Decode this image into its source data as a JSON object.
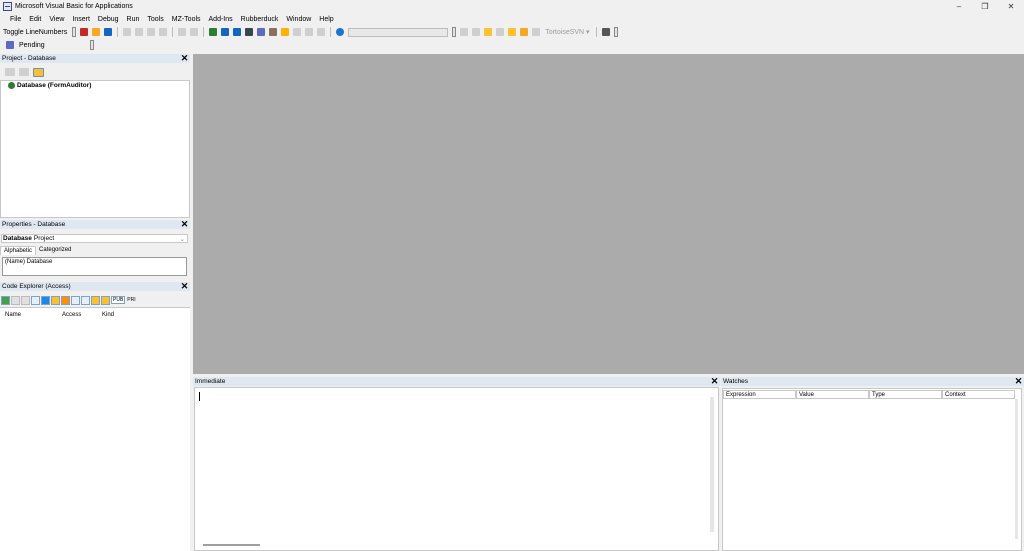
{
  "window": {
    "title": "Microsoft Visual Basic for Applications",
    "controls": {
      "minimize": "–",
      "maximize": "❐",
      "close": "✕"
    }
  },
  "menu": [
    "File",
    "Edit",
    "View",
    "Insert",
    "Debug",
    "Run",
    "Tools",
    "MZ-Tools",
    "Add-Ins",
    "Rubberduck",
    "Window",
    "Help"
  ],
  "toolbar": {
    "toggle_label": "Toggle LineNumbers",
    "tortoise_label": "TortoiseSVN ▾"
  },
  "toolbar2": {
    "pending_label": "Pending"
  },
  "project": {
    "title": "Project - Database",
    "tree_item": "Database (FormAuditor)"
  },
  "properties": {
    "title": "Properties - Database",
    "object_name": "Database",
    "object_type": "Project",
    "tabs": [
      "Alphabetic",
      "Categorized"
    ],
    "grid_row": "(Name) Database"
  },
  "code_explorer": {
    "title": "Code Explorer (Access)",
    "pub_label": "PUB",
    "pri_label": "PRI",
    "columns": [
      "Name",
      "Access",
      "Kind"
    ]
  },
  "immediate": {
    "title": "Immediate"
  },
  "watches": {
    "title": "Watches",
    "columns": [
      "Expression",
      "Value",
      "Type",
      "Context"
    ]
  },
  "colors": {
    "panel_header": "#dfe7f1",
    "mdi_background": "#ababab"
  }
}
